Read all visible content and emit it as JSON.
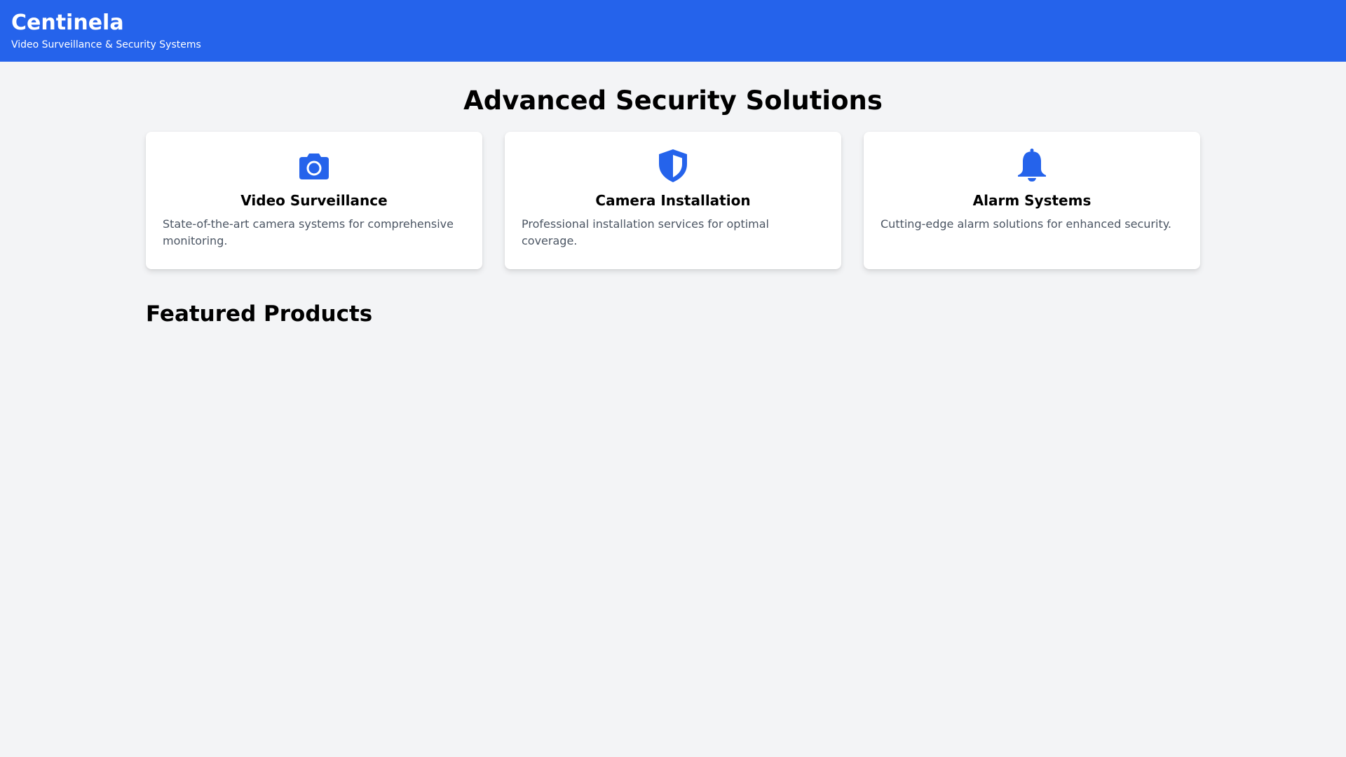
{
  "header": {
    "brand": "Centinela",
    "tagline": "Video Surveillance & Security Systems",
    "background_color": "#2563eb"
  },
  "main": {
    "hero_title": "Advanced Security Solutions",
    "accent_color": "#2563eb",
    "cards": [
      {
        "icon": "camera-icon",
        "title": "Video Surveillance",
        "description": "State-of-the-art camera systems for comprehensive monitoring."
      },
      {
        "icon": "shield-icon",
        "title": "Camera Installation",
        "description": "Professional installation services for optimal coverage."
      },
      {
        "icon": "bell-icon",
        "title": "Alarm Systems",
        "description": "Cutting-edge alarm solutions for enhanced security."
      }
    ],
    "featured_title": "Featured Products"
  }
}
